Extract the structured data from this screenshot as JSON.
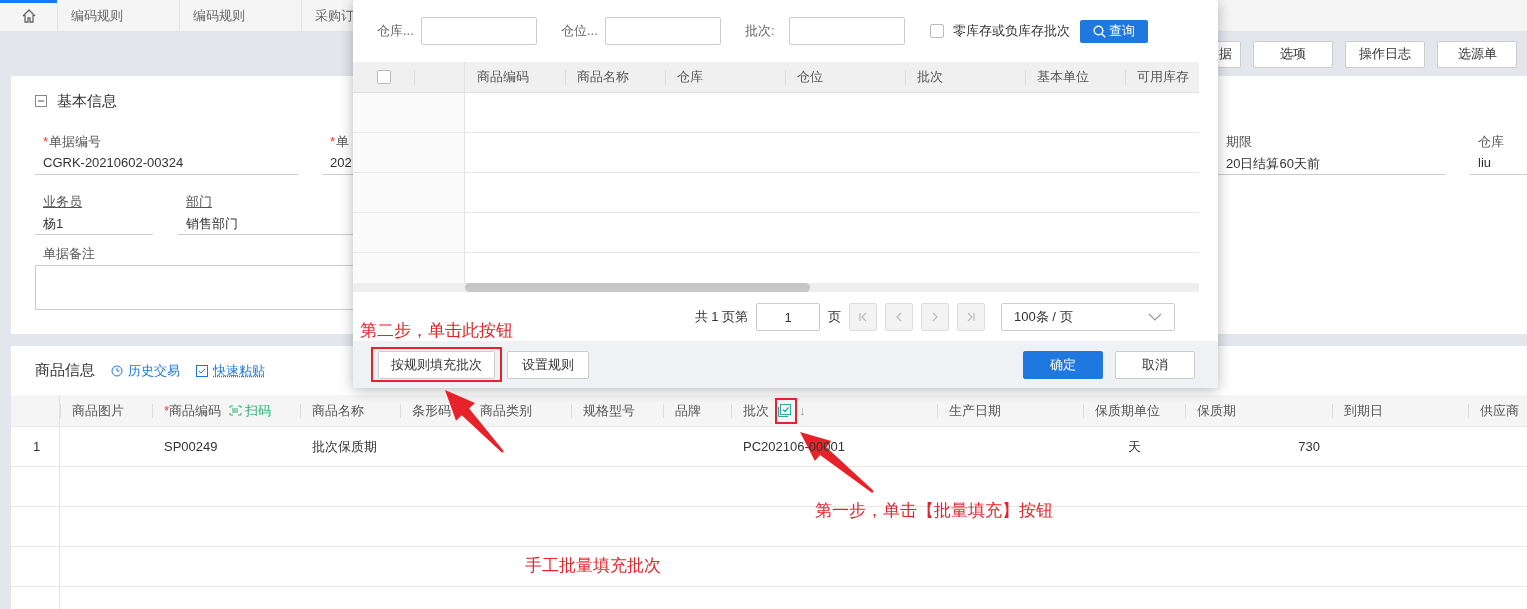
{
  "tabs": [
    {
      "kind": "home",
      "selected": true
    },
    {
      "label": "编码规则",
      "selected": false
    },
    {
      "label": "编码规则",
      "selected": false
    },
    {
      "label": "采购订",
      "selected": false
    }
  ],
  "toolbar_buttons": [
    "据",
    "选项",
    "操作日志",
    "选源单"
  ],
  "basic_info": {
    "title": "基本信息",
    "expanded": true,
    "rows": [
      [
        {
          "label": "单据编号",
          "required_mark": "*",
          "value": "CGRK-20210602-00324",
          "link": false
        },
        {
          "label": "单",
          "required_mark": "*",
          "value": "202",
          "link": false
        },
        {
          "label": "期限",
          "value": "20日结算60天前",
          "kind": "partial",
          "link": false
        },
        {
          "label": "仓库",
          "value": "liu",
          "link": false
        }
      ],
      [
        {
          "label": "业务员",
          "value": "杨1",
          "link": true
        },
        {
          "label": "部门",
          "value": "销售部门",
          "link": true
        }
      ]
    ],
    "remark": {
      "label": "单据备注"
    }
  },
  "goods": {
    "title": "商品信息",
    "links": [
      {
        "label": "历史交易",
        "kind": "history"
      },
      {
        "label": "快速粘贴",
        "kind": "paste"
      }
    ],
    "columns": [
      {
        "label": "商品图片"
      },
      {
        "label": "商品编码",
        "required_mark": "*",
        "scan_label": "扫码"
      },
      {
        "label": "商品名称"
      },
      {
        "label": "条形码"
      },
      {
        "label": "商品类别"
      },
      {
        "label": "规格型号"
      },
      {
        "label": "品牌"
      },
      {
        "label": "批次",
        "batch_fill_icon": true,
        "sort_mark": "↓"
      },
      {
        "label": "生产日期"
      },
      {
        "label": "保质期单位"
      },
      {
        "label": "保质期"
      },
      {
        "label": "到期日"
      },
      {
        "label": "供应商"
      }
    ],
    "rows": [
      {
        "index": "1",
        "cells": [
          null,
          "SP00249",
          "批次保质期",
          null,
          null,
          null,
          null,
          "PC202106-00001",
          null,
          "天",
          "730",
          null,
          null
        ]
      }
    ]
  },
  "batch_dialog": {
    "filters": [
      {
        "label": "仓库..."
      },
      {
        "label": "仓位..."
      },
      {
        "label": "批次:"
      }
    ],
    "zero_stock": {
      "label": "零库存或负库存批次",
      "checked": false
    },
    "query_button": "查询",
    "select_all_checked": false,
    "columns": [
      "商品编码",
      "商品名称",
      "仓库",
      "仓位",
      "批次",
      "基本单位",
      "可用库存"
    ],
    "pagination": {
      "prefix": "共 1 页第",
      "page": "1",
      "suffix": "页",
      "page_size": "100条 / 页",
      "nav": [
        {
          "kind": "first",
          "disabled": true
        },
        {
          "kind": "prev",
          "disabled": true
        },
        {
          "kind": "next",
          "disabled": true
        },
        {
          "kind": "last",
          "disabled": true
        }
      ]
    },
    "buttons": [
      {
        "label": "按规则填充批次",
        "kind": "default"
      },
      {
        "label": "设置规则",
        "kind": "default"
      },
      {
        "label": "确定",
        "kind": "primary"
      },
      {
        "label": "取消",
        "kind": "default"
      }
    ]
  },
  "annotations": [
    {
      "text": "第二步，单击此按钮"
    },
    {
      "text": "第一步，单击【批量填充】按钮"
    },
    {
      "text": "手工批量填充批次"
    }
  ]
}
